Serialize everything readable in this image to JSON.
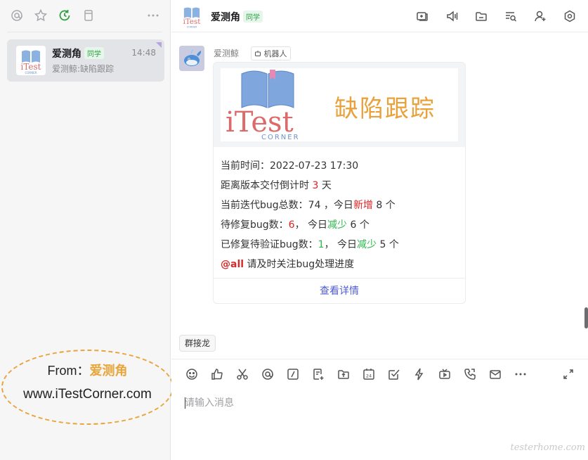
{
  "sidebar": {
    "toolbar": [
      {
        "name": "mention-filter",
        "icon": "at-icon"
      },
      {
        "name": "star-filter",
        "icon": "star-icon"
      },
      {
        "name": "recent-filter",
        "icon": "clock-refresh-icon"
      },
      {
        "name": "docs-filter",
        "icon": "doc-icon"
      },
      {
        "name": "more",
        "icon": "more-icon"
      }
    ],
    "chat": {
      "name": "爱测角",
      "tag": "同学",
      "time": "14:48",
      "preview": "爱测鲸:缺陷跟踪"
    }
  },
  "logo": {
    "text": "iTest",
    "sub": "CORNER"
  },
  "stamp": {
    "line1_prefix": "From：",
    "line1_org": "爱测角",
    "line2": "www.iTestCorner.com",
    "color": "#e8a53a"
  },
  "header": {
    "title": "爱测角",
    "tag": "同学",
    "icons": [
      "screen-share-icon",
      "speaker-icon",
      "folder-icon",
      "search-list-icon",
      "add-user-icon",
      "settings-icon"
    ]
  },
  "message": {
    "sender": "爱测鲸",
    "badge": "机器人",
    "banner_title": "缺陷跟踪",
    "lines": {
      "time_label": "当前时间：",
      "time_value": "2022-07-23 17:30",
      "countdown_prefix": "距离版本交付倒计时 ",
      "countdown_value": "3",
      "countdown_suffix": " 天",
      "total_prefix": "当前迭代bug总数：",
      "total_value": "74",
      "total_mid": " ，今日",
      "total_new": "新增",
      "total_suffix": " 8 个",
      "pending_prefix": "待修复bug数：",
      "pending_value": "6",
      "pending_mid": "， 今日",
      "pending_reduce": "减少",
      "pending_suffix": " 6 个",
      "verify_prefix": "已修复待验证bug数：",
      "verify_value": "1",
      "verify_mid": "， 今日",
      "verify_reduce": "减少",
      "verify_suffix": " 5 个",
      "mention": "@all",
      "mention_text": " 请及时关注bug处理进度"
    },
    "button": "查看详情"
  },
  "chip": "群接龙",
  "compose": {
    "placeholder": "请输入消息",
    "tools": [
      "emoji-icon",
      "thumbs-up-icon",
      "scissors-icon",
      "at-icon",
      "slash-command-icon",
      "new-doc-icon",
      "upload-icon",
      "calendar-icon",
      "checkbox-icon",
      "lightning-icon",
      "tv-icon",
      "phone-icon",
      "mail-icon",
      "more-icon",
      "expand-icon"
    ]
  },
  "watermark": "testerhome.com",
  "colors": {
    "accent": "#4f5bd5",
    "red": "#e02020",
    "green": "#2db84d",
    "orange": "#e9a23b"
  }
}
